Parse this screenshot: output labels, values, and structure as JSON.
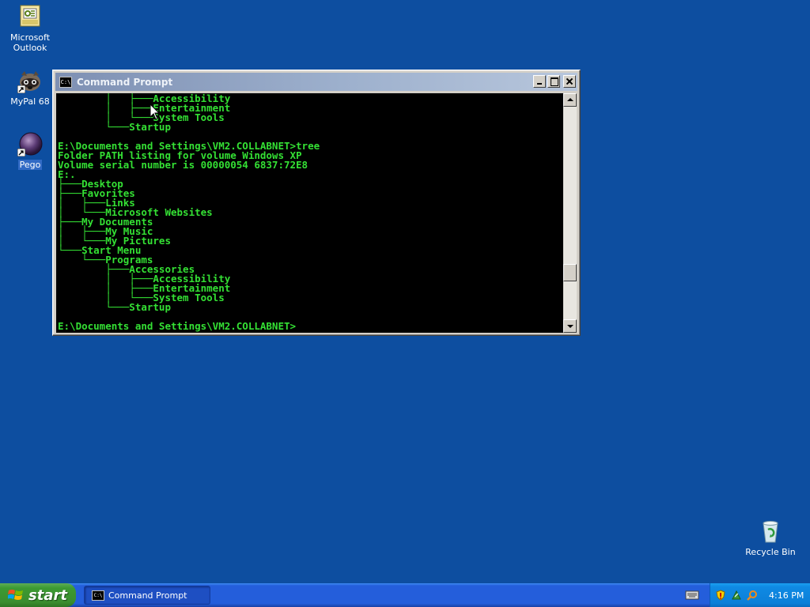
{
  "desktop": {
    "background_color": "#0d4ea0",
    "icons": [
      {
        "label": "Microsoft Outlook",
        "icon": "outlook-icon"
      },
      {
        "label": "MyPal 68",
        "icon": "mypal-raccoon-icon"
      },
      {
        "label": "Pego",
        "icon": "pego-icon"
      },
      {
        "label": "Recycle Bin",
        "icon": "recycle-bin-icon"
      }
    ]
  },
  "window": {
    "title": "Command Prompt",
    "icon_text": "C:\\",
    "console_color": "#34e034",
    "lines": [
      "        │   ├───Accessibility",
      "        │   ├───Entertainment",
      "        │   └───System Tools",
      "        └───Startup",
      "",
      "E:\\Documents and Settings\\VM2.COLLABNET>tree",
      "Folder PATH listing for volume Windows XP",
      "Volume serial number is 00000054 6837:72E8",
      "E:.",
      "├───Desktop",
      "├───Favorites",
      "│   ├───Links",
      "│   └───Microsoft Websites",
      "├───My Documents",
      "│   ├───My Music",
      "│   └───My Pictures",
      "└───Start Menu",
      "    └───Programs",
      "        ├───Accessories",
      "        │   ├───Accessibility",
      "        │   ├───Entertainment",
      "        │   └───System Tools",
      "        └───Startup",
      "",
      "E:\\Documents and Settings\\VM2.COLLABNET>"
    ]
  },
  "taskbar": {
    "start_label": "start",
    "task_label": "Command Prompt",
    "task_icon_text": "C:\\",
    "clock": "4:16 PM"
  }
}
